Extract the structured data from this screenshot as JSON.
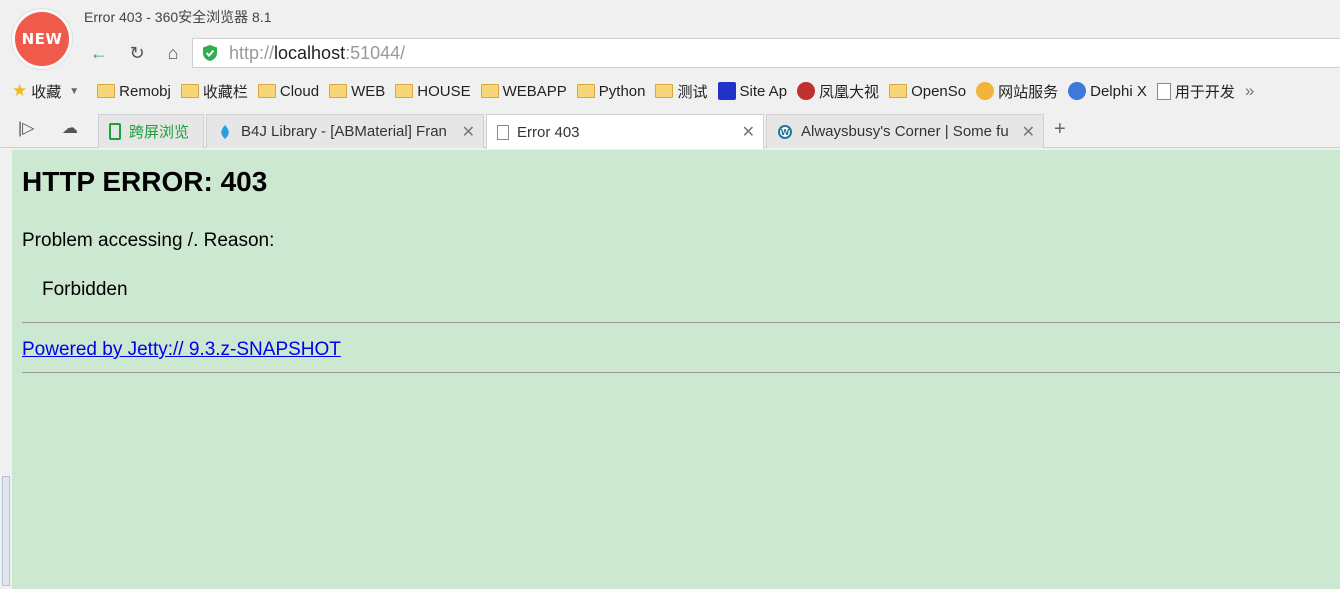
{
  "window": {
    "title": "Error 403 - 360安全浏览器 8.1",
    "logo_text": "NEW"
  },
  "address": {
    "scheme": "http://",
    "host": "localhost",
    "port": ":51044/"
  },
  "bookmarks": [
    {
      "label": "收藏",
      "icon": "star-icon"
    },
    {
      "label": "Remobj",
      "icon": "folder-icon"
    },
    {
      "label": "收藏栏",
      "icon": "folder-icon"
    },
    {
      "label": "Cloud",
      "icon": "folder-icon"
    },
    {
      "label": "WEB",
      "icon": "folder-icon"
    },
    {
      "label": "HOUSE",
      "icon": "folder-icon"
    },
    {
      "label": "WEBAPP",
      "icon": "folder-icon"
    },
    {
      "label": "Python",
      "icon": "folder-icon"
    },
    {
      "label": "测试",
      "icon": "folder-icon"
    },
    {
      "label": "Site Ap",
      "icon": "paw-icon"
    },
    {
      "label": "凤凰大视",
      "icon": "phoenix-icon"
    },
    {
      "label": "OpenSo",
      "icon": "folder-icon"
    },
    {
      "label": "网站服务",
      "icon": "service-icon"
    },
    {
      "label": "Delphi X",
      "icon": "delphi-icon"
    },
    {
      "label": "用于开发",
      "icon": "page-icon"
    }
  ],
  "tabs": [
    {
      "label": "跨屏浏览",
      "icon": "phone-icon"
    },
    {
      "label": "B4J Library - [ABMaterial] Fran",
      "icon": "b4j-icon"
    },
    {
      "label": "Error 403",
      "icon": "page-icon",
      "active": true
    },
    {
      "label": "Alwaysbusy's Corner | Some fu",
      "icon": "wordpress-icon"
    }
  ],
  "page": {
    "heading": "HTTP ERROR: 403",
    "problem": "Problem accessing /. Reason:",
    "reason": "Forbidden",
    "powered_link": "Powered by Jetty:// 9.3.z-SNAPSHOT"
  },
  "colors": {
    "page_bg": "#cde8d0",
    "link": "#0000ee",
    "logo": "#f05a4a"
  }
}
